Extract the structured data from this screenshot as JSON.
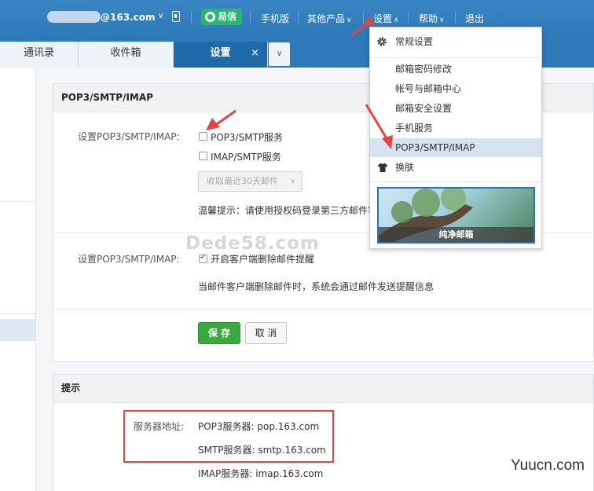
{
  "header": {
    "email": "@163.com",
    "yixin": "易信",
    "mobile": "手机版",
    "other_products": "其他产品",
    "settings": "设置",
    "help": "帮助",
    "logout": "退出"
  },
  "tabs": [
    {
      "label": "通讯录"
    },
    {
      "label": "收件箱"
    },
    {
      "label": "设置"
    }
  ],
  "tab_close": "×",
  "section1": {
    "title": "POP3/SMTP/IMAP",
    "label1": "设置POP3/SMTP/IMAP:",
    "opt_pop3": "POP3/SMTP服务",
    "opt_imap": "IMAP/SMTP服务",
    "select_value": "收取最近30天邮件",
    "tip": "温馨提示：请使用授权码登录第三方邮件客",
    "label2": "设置POP3/SMTP/IMAP:",
    "opt_delete": "开启客户端删除邮件提醒",
    "delete_note": "当邮件客户端删除邮件时，系统会通过邮件发送提醒信息",
    "save": "保 存",
    "cancel": "取 消"
  },
  "section2": {
    "title": "提示",
    "server_label": "服务器地址:",
    "pop3": "POP3服务器: pop.163.com",
    "smtp": "SMTP服务器: smtp.163.com",
    "imap": "IMAP服务器: imap.163.com"
  },
  "dropdown": {
    "items": [
      {
        "label": "常规设置"
      },
      {
        "label": "邮箱密码修改"
      },
      {
        "label": "帐号与邮箱中心"
      },
      {
        "label": "邮箱安全设置"
      },
      {
        "label": "手机服务"
      },
      {
        "label": "POP3/SMTP/IMAP"
      },
      {
        "label": "换肤"
      }
    ],
    "theme_label": "纯净邮箱"
  },
  "watermark": "Dede58.com",
  "site_mark": "Yuucn.com",
  "colors": {
    "header_blue": "#2e79b8",
    "active_tab": "#1f6aa8",
    "save_green": "#3aaa3f",
    "annotation_red": "#e24545",
    "yixin_green": "#2db56e"
  }
}
